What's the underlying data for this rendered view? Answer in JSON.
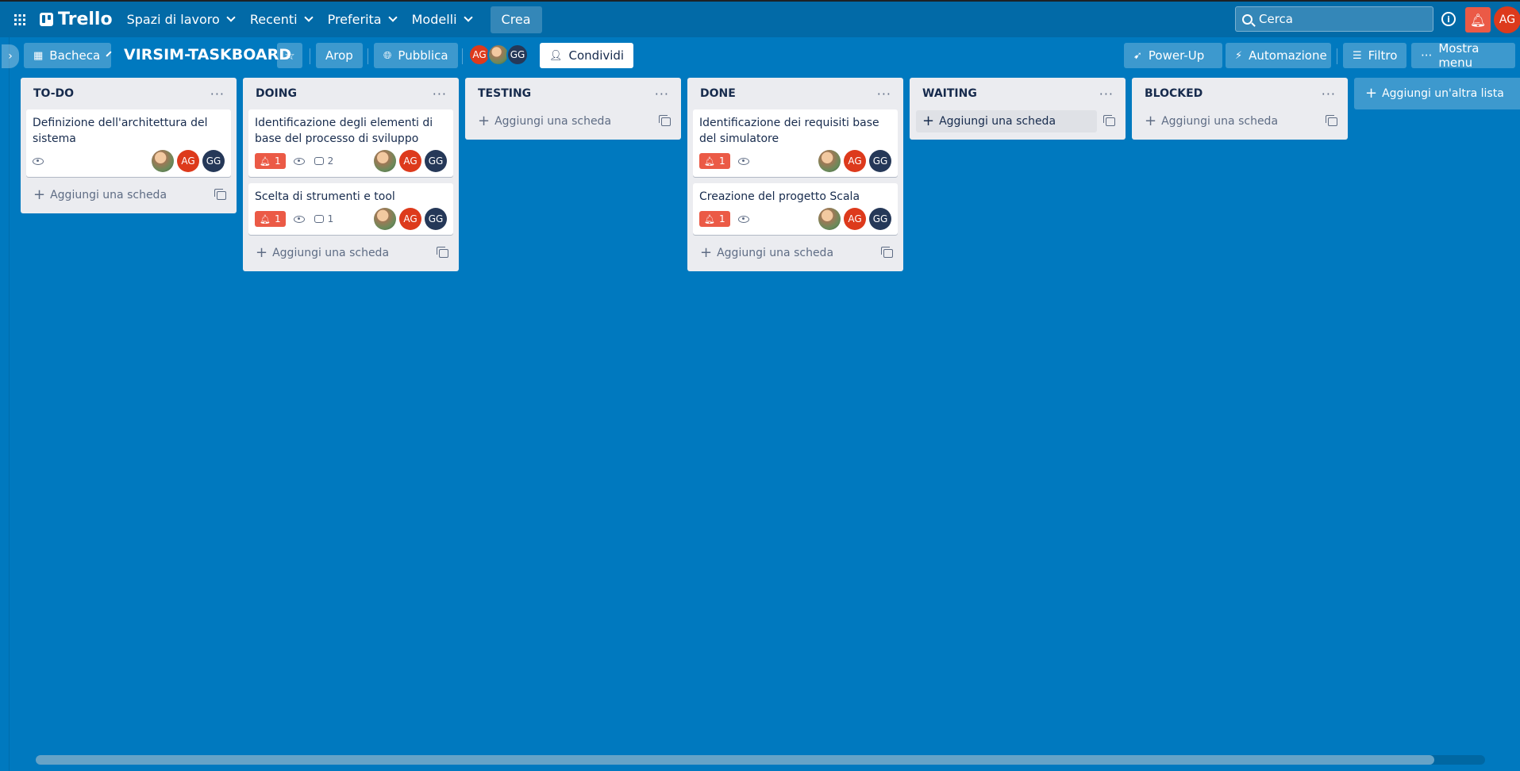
{
  "topbar": {
    "brand": "Trello",
    "menus": [
      "Spazi di lavoro",
      "Recenti",
      "Preferita",
      "Modelli"
    ],
    "create_label": "Crea",
    "search_placeholder": "Cerca",
    "user_initials": "AG",
    "notification_color": "#eb5a46"
  },
  "boardbar": {
    "view_label": "Bacheca",
    "board_title": "VIRSIM-TASKBOARD",
    "workspace_label": "Arop",
    "visibility_label": "Pubblica",
    "members": [
      "AG",
      "photo",
      "GG"
    ],
    "share_label": "Condividi",
    "powerup_label": "Power-Up",
    "automation_label": "Automazione",
    "filter_label": "Filtro",
    "menu_label": "Mostra menu"
  },
  "add_card_label": "Aggiungi una scheda",
  "add_list_label": "Aggiungi un'altra lista",
  "lists": [
    {
      "title": "TO-DO",
      "cards": [
        {
          "title": "Definizione dell'architettura del sistema",
          "due": null,
          "comments": null
        }
      ]
    },
    {
      "title": "DOING",
      "cards": [
        {
          "title": "Identificazione degli elementi di base del processo di sviluppo",
          "due": "1",
          "comments": "2"
        },
        {
          "title": "Scelta di strumenti e tool",
          "due": "1",
          "comments": "1"
        }
      ]
    },
    {
      "title": "TESTING",
      "cards": []
    },
    {
      "title": "DONE",
      "cards": [
        {
          "title": "Identificazione dei requisiti base del simulatore",
          "due": "1",
          "comments": null
        },
        {
          "title": "Creazione del progetto Scala",
          "due": "1",
          "comments": null
        }
      ]
    },
    {
      "title": "WAITING",
      "cards": []
    },
    {
      "title": "BLOCKED",
      "cards": []
    }
  ],
  "colors": {
    "board_bg": "#0079bf",
    "header_bg": "#026aa7",
    "avatar_ag": "#dd3a1c",
    "avatar_gg": "#253858",
    "due_badge": "#eb5a46"
  }
}
